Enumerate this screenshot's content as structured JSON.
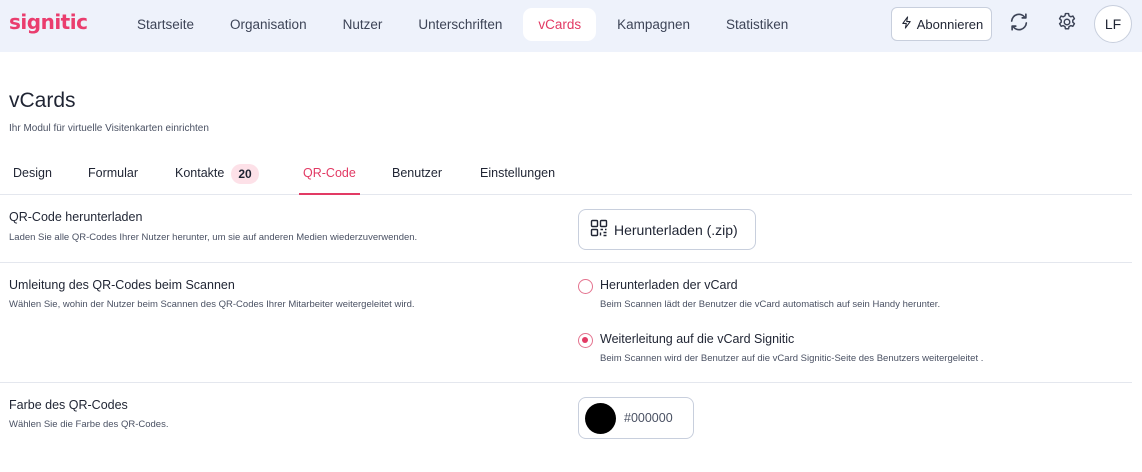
{
  "app": {
    "logo": "signitic"
  },
  "nav": {
    "items": [
      {
        "label": "Startseite"
      },
      {
        "label": "Organisation"
      },
      {
        "label": "Nutzer"
      },
      {
        "label": "Unterschriften"
      },
      {
        "label": "vCards",
        "active": true
      },
      {
        "label": "Kampagnen"
      },
      {
        "label": "Statistiken"
      }
    ],
    "subscribe_label": "Abonnieren",
    "subscribe_icon": "lightning-icon",
    "sync_icon": "sync-icon",
    "settings_icon": "gear-icon",
    "avatar_initials": "LF"
  },
  "page": {
    "title": "vCards",
    "subtitle": "Ihr Modul für virtuelle Visitenkarten einrichten"
  },
  "tabs": [
    {
      "label": "Design"
    },
    {
      "label": "Formular"
    },
    {
      "label": "Kontakte",
      "count": "20"
    },
    {
      "label": "QR-Code",
      "active": true
    },
    {
      "label": "Benutzer"
    },
    {
      "label": "Einstellungen"
    }
  ],
  "qr_download": {
    "title": "QR-Code herunterladen",
    "description": "Laden Sie alle QR-Codes Ihrer Nutzer herunter, um sie auf anderen Medien wiederzuverwenden.",
    "button_label": "Herunterladen (.zip)",
    "button_icon": "qr-code-icon"
  },
  "redirect": {
    "title": "Umleitung des QR-Codes beim Scannen",
    "description": "Wählen Sie, wohin der Nutzer beim Scannen des QR-Codes Ihrer Mitarbeiter weitergeleitet wird.",
    "options": [
      {
        "label": "Herunterladen der vCard",
        "description": "Beim Scannen lädt der Benutzer die vCard automatisch auf sein Handy herunter.",
        "selected": false
      },
      {
        "label": "Weiterleitung auf die vCard Signitic",
        "description": "Beim Scannen wird der Benutzer auf die vCard Signitic-Seite des Benutzers weitergeleitet .",
        "selected": true
      }
    ]
  },
  "qr_color": {
    "title": "Farbe des QR-Codes",
    "description": "Wählen Sie die Farbe des QR-Codes.",
    "value": "#000000"
  },
  "colors": {
    "accent": "#e23a64",
    "brand": "#ea3d6e",
    "topbar_bg": "#eef2fb",
    "count_badge_bg": "#fde1e8"
  }
}
